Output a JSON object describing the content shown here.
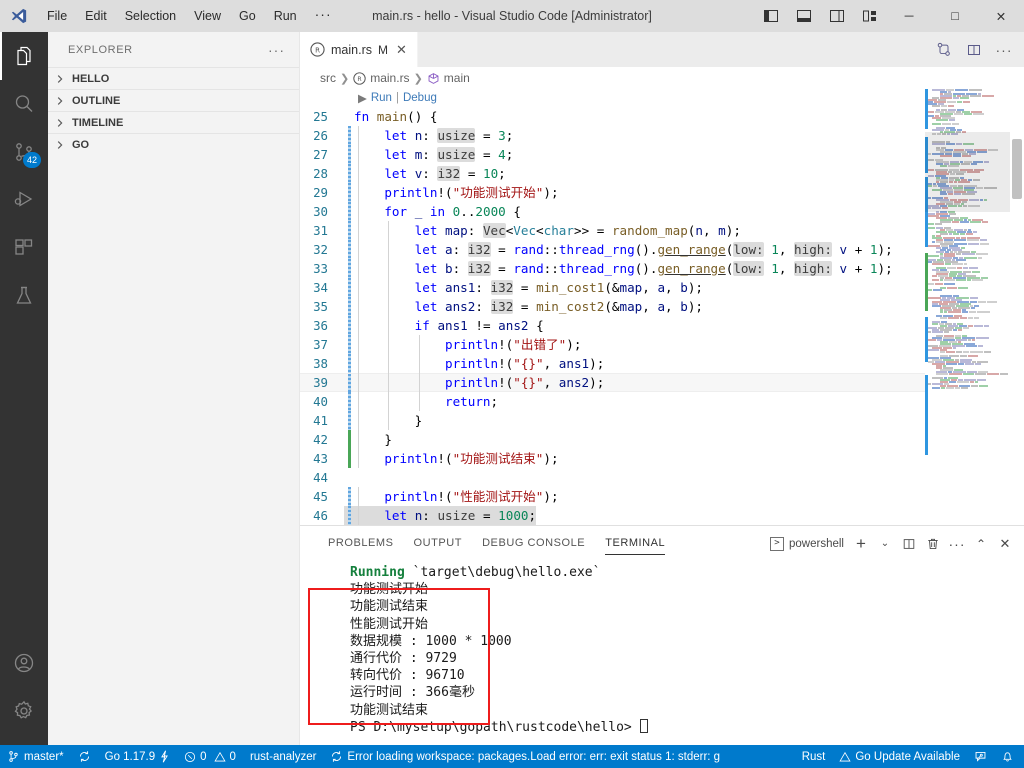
{
  "window": {
    "title": "main.rs - hello - Visual Studio Code [Administrator]",
    "menu": [
      "File",
      "Edit",
      "Selection",
      "View",
      "Go",
      "Run"
    ],
    "menu_more": "···",
    "layout_icons": [
      "toggle-primary-sidebar-icon",
      "toggle-panel-icon",
      "toggle-secondary-sidebar-icon",
      "customize-layout-icon"
    ],
    "controls": {
      "minimize": "─",
      "maximize": "□",
      "close": "✕"
    }
  },
  "activitybar": {
    "items": [
      {
        "name": "explorer",
        "active": true
      },
      {
        "name": "search",
        "active": false
      },
      {
        "name": "source-control",
        "active": false,
        "badge": "42"
      },
      {
        "name": "run-and-debug",
        "active": false
      },
      {
        "name": "extensions",
        "active": false
      },
      {
        "name": "testing",
        "active": false
      }
    ],
    "bottom": [
      {
        "name": "accounts"
      },
      {
        "name": "manage-settings"
      }
    ]
  },
  "sidebar": {
    "title": "EXPLORER",
    "more_label": "···",
    "sections": [
      {
        "label": "HELLO",
        "expanded": false
      },
      {
        "label": "OUTLINE",
        "expanded": false
      },
      {
        "label": "TIMELINE",
        "expanded": false
      },
      {
        "label": "GO",
        "expanded": false
      }
    ]
  },
  "editor": {
    "tab": {
      "label": "main.rs",
      "dirty_badge": "M",
      "close": "✕"
    },
    "actions": [
      "split-editor-right-icon",
      "toggle-layout-icon",
      "more-actions-icon"
    ],
    "breadcrumb": [
      "src",
      "main.rs",
      "main"
    ],
    "codelens": {
      "run": "Run",
      "sep": "|",
      "debug": "Debug"
    },
    "first_line": 25,
    "current_line": 39,
    "lines": [
      {
        "n": 25,
        "indent": 0,
        "gutter": "",
        "text": "fn main() {"
      },
      {
        "n": 26,
        "indent": 1,
        "gutter": "blue",
        "text": "let n: usize = 3;"
      },
      {
        "n": 27,
        "indent": 1,
        "gutter": "blue",
        "text": "let m: usize = 4;"
      },
      {
        "n": 28,
        "indent": 1,
        "gutter": "blue",
        "text": "let v: i32 = 10;"
      },
      {
        "n": 29,
        "indent": 1,
        "gutter": "blue",
        "text": "println!(\"功能测试开始\");"
      },
      {
        "n": 30,
        "indent": 1,
        "gutter": "blue",
        "text": "for _ in 0..2000 {"
      },
      {
        "n": 31,
        "indent": 2,
        "gutter": "blue",
        "text": "let map: Vec<Vec<char>> = random_map(n, m);"
      },
      {
        "n": 32,
        "indent": 2,
        "gutter": "blue",
        "text": "let a: i32 = rand::thread_rng().gen_range(low: 1, high: v + 1);"
      },
      {
        "n": 33,
        "indent": 2,
        "gutter": "blue",
        "text": "let b: i32 = rand::thread_rng().gen_range(low: 1, high: v + 1);"
      },
      {
        "n": 34,
        "indent": 2,
        "gutter": "blue",
        "text": "let ans1: i32 = min_cost1(&map, a, b);"
      },
      {
        "n": 35,
        "indent": 2,
        "gutter": "blue",
        "text": "let ans2: i32 = min_cost2(&map, a, b);"
      },
      {
        "n": 36,
        "indent": 2,
        "gutter": "blue",
        "text": "if ans1 != ans2 {"
      },
      {
        "n": 37,
        "indent": 3,
        "gutter": "blue",
        "text": "println!(\"出错了\");"
      },
      {
        "n": 38,
        "indent": 3,
        "gutter": "blue",
        "text": "println!(\"{}\", ans1);"
      },
      {
        "n": 39,
        "indent": 3,
        "gutter": "blue",
        "text": "println!(\"{}\", ans2);"
      },
      {
        "n": 40,
        "indent": 3,
        "gutter": "blue",
        "text": "return;"
      },
      {
        "n": 41,
        "indent": 2,
        "gutter": "blue",
        "text": "}"
      },
      {
        "n": 42,
        "indent": 1,
        "gutter": "green",
        "text": "}"
      },
      {
        "n": 43,
        "indent": 1,
        "gutter": "green",
        "text": "println!(\"功能测试结束\");"
      },
      {
        "n": 44,
        "indent": 0,
        "gutter": "",
        "text": ""
      },
      {
        "n": 45,
        "indent": 1,
        "gutter": "blue",
        "text": "println!(\"性能测试开始\");"
      },
      {
        "n": 46,
        "indent": 1,
        "gutter": "blue",
        "text": "let n: usize = 1000;"
      }
    ]
  },
  "panel": {
    "tabs": [
      "PROBLEMS",
      "OUTPUT",
      "DEBUG CONSOLE",
      "TERMINAL"
    ],
    "active_tab": "TERMINAL",
    "terminal_name": "powershell",
    "actions": [
      "new-terminal-icon",
      "terminal-dropdown-icon",
      "split-terminal-icon",
      "kill-terminal-icon",
      "views-and-more-icon",
      "maximize-panel-icon",
      "close-panel-icon"
    ],
    "terminal_lines": [
      {
        "text": "     Running `target\\debug\\hello.exe`",
        "style": "running"
      },
      {
        "text": "功能测试开始",
        "style": "plain"
      },
      {
        "text": "功能测试结束",
        "style": "plain"
      },
      {
        "text": "性能测试开始",
        "style": "plain"
      },
      {
        "text": "数据规模 : 1000 * 1000",
        "style": "plain"
      },
      {
        "text": "通行代价 : 9729",
        "style": "plain"
      },
      {
        "text": "转向代价 : 96710",
        "style": "plain"
      },
      {
        "text": "运行时间 : 366毫秒",
        "style": "plain"
      },
      {
        "text": "功能测试结束",
        "style": "plain"
      }
    ],
    "prompt": "PS D:\\mysetup\\gopath\\rustcode\\hello> ",
    "running_prefix": "Running",
    "running_rest": " `target\\debug\\hello.exe`"
  },
  "statusbar": {
    "branch": "master*",
    "sync_icon": "sync-icon",
    "go_version": "Go 1.17.9",
    "errors": "0",
    "warnings": "0",
    "rust_analyzer": "rust-analyzer",
    "workspace_error": "Error loading workspace: packages.Load error: err: exit status 1: stderr: g",
    "language": "Rust",
    "go_update": "Go Update Available",
    "feedback_icon": "feedback-icon",
    "bell_icon": "notifications-icon"
  },
  "colors": {
    "accent": "#007acc",
    "titlebar_bg": "#dddddd",
    "activitybar_bg": "#333333",
    "sidebar_bg": "#f3f3f3",
    "editor_bg": "#ffffff",
    "redbox": "#ee1c1c",
    "terminal_green": "#15803d"
  }
}
